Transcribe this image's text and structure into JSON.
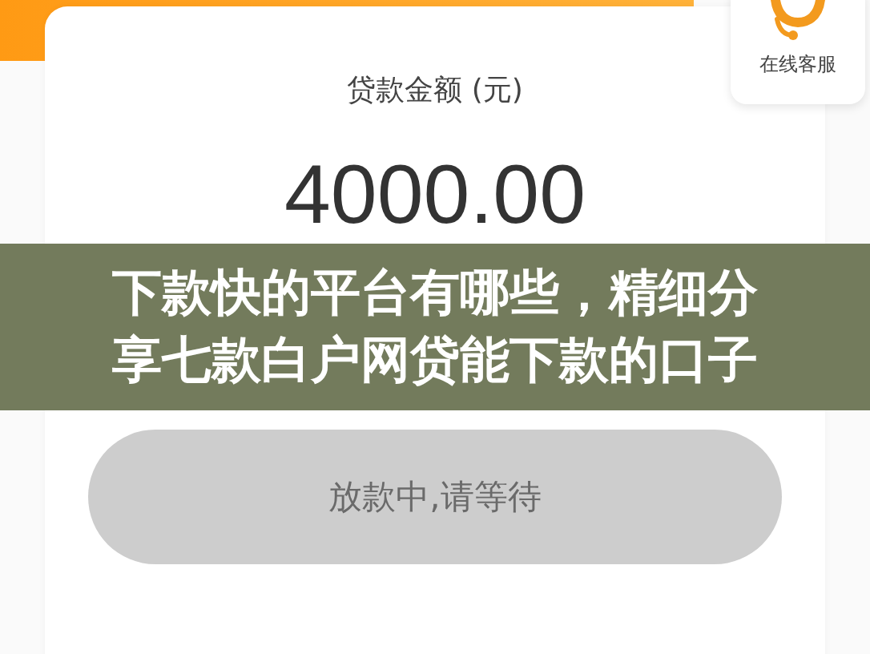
{
  "customer_service": {
    "label": "在线客服"
  },
  "loan": {
    "label": "贷款金额 (元)",
    "amount": "4000.00"
  },
  "banner": {
    "lines": [
      "下款快的平台有哪些，精细分",
      "享七款白户网贷能下款的口子"
    ]
  },
  "status_button": {
    "label": "放款中,请等待",
    "disabled": true
  }
}
